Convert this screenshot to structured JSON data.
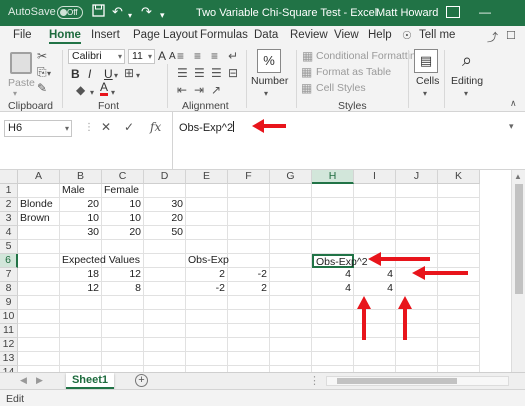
{
  "titlebar": {
    "autosave_label": "AutoSave",
    "autosave_state": "Off",
    "title": "Two Variable Chi-Square Test  -  Excel",
    "user": "Matt Howard"
  },
  "tabs": [
    {
      "label": "File"
    },
    {
      "label": "Home"
    },
    {
      "label": "Insert"
    },
    {
      "label": "Page Layout"
    },
    {
      "label": "Formulas"
    },
    {
      "label": "Data"
    },
    {
      "label": "Review"
    },
    {
      "label": "View"
    },
    {
      "label": "Help"
    },
    {
      "label": "Tell me"
    }
  ],
  "ribbon": {
    "clipboard": {
      "label": "Clipboard",
      "paste": "Paste"
    },
    "font": {
      "label": "Font",
      "name": "Calibri",
      "size": "11",
      "bold": "B",
      "italic": "I",
      "underline": "U"
    },
    "alignment": {
      "label": "Alignment"
    },
    "number": {
      "label": "Number",
      "icon": "%"
    },
    "styles": {
      "label": "Styles",
      "conditional": "Conditional Formatting",
      "format_table": "Format as Table",
      "cell_styles": "Cell Styles"
    },
    "cells": {
      "label": "Cells"
    },
    "editing": {
      "label": "Editing"
    }
  },
  "formula_bar": {
    "name_box": "H6",
    "fx": "fx",
    "formula": "Obs-Exp^2"
  },
  "grid": {
    "columns": [
      "A",
      "B",
      "C",
      "D",
      "E",
      "F",
      "G",
      "H",
      "I",
      "J",
      "K"
    ],
    "rows": [
      "1",
      "2",
      "3",
      "4",
      "5",
      "6",
      "7",
      "8",
      "9",
      "10",
      "11",
      "12",
      "13",
      "14"
    ],
    "cells": {
      "B1": "Male",
      "C1": "Female",
      "A2": "Blonde",
      "B2": "20",
      "C2": "10",
      "D2": "30",
      "A3": "Brown",
      "B3": "10",
      "C3": "10",
      "D3": "20",
      "B4": "30",
      "C4": "20",
      "D4": "50",
      "B6": "Expected Values",
      "E6": "Obs-Exp",
      "H6": "Obs-Exp^2",
      "B7": "18",
      "C7": "12",
      "E7": "2",
      "F7": "-2",
      "H7": "4",
      "I7": "4",
      "B8": "12",
      "C8": "8",
      "E8": "-2",
      "F8": "2",
      "H8": "4",
      "I8": "4"
    }
  },
  "sheets": [
    {
      "label": "Sheet1"
    }
  ],
  "status": {
    "mode": "Edit"
  },
  "colors": {
    "accent": "#217346",
    "annotation": "#e8141b"
  }
}
